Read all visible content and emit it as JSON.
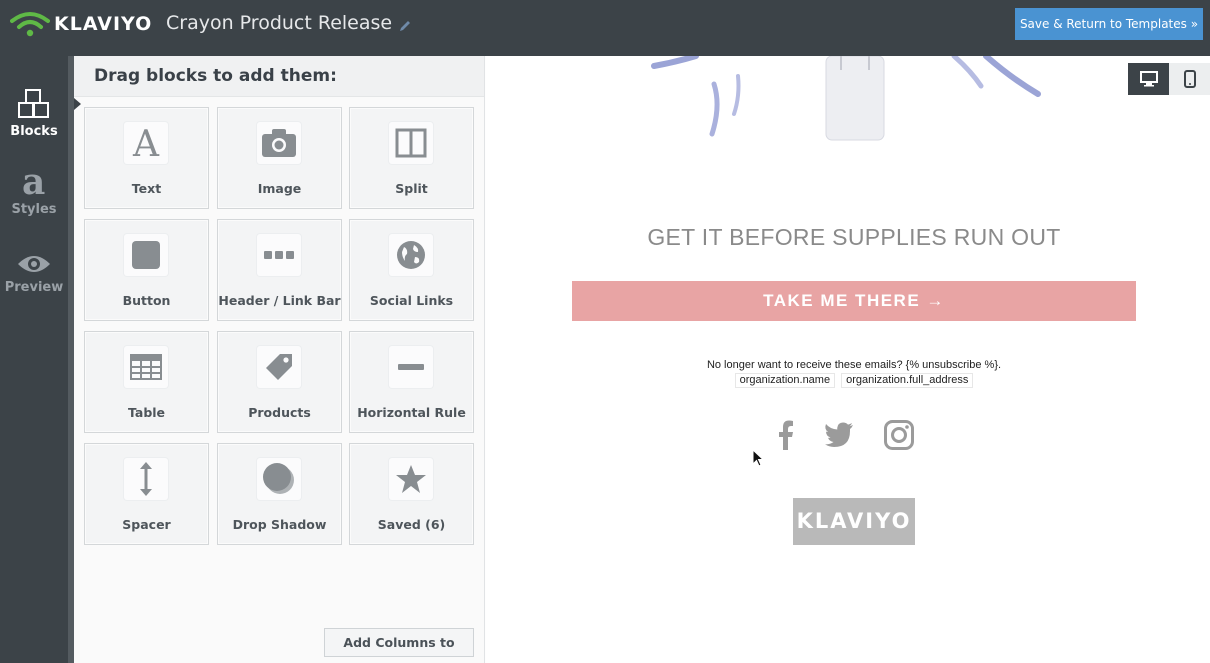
{
  "app": {
    "brand": "KLAVIYO",
    "document_title": "Crayon Product Release",
    "save_button": "Save & Return to Templates »"
  },
  "sidebar": {
    "items": [
      {
        "label": "Blocks",
        "icon": "blocks-icon",
        "active": true
      },
      {
        "label": "Styles",
        "icon": "styles-icon",
        "active": false
      },
      {
        "label": "Preview",
        "icon": "eye-icon",
        "active": false
      }
    ]
  },
  "panel": {
    "heading": "Drag blocks to add them:",
    "blocks": [
      {
        "label": "Text",
        "icon": "text-icon"
      },
      {
        "label": "Image",
        "icon": "camera-icon"
      },
      {
        "label": "Split",
        "icon": "split-icon"
      },
      {
        "label": "Button",
        "icon": "button-icon"
      },
      {
        "label": "Header / Link Bar",
        "icon": "link-bar-icon"
      },
      {
        "label": "Social Links",
        "icon": "globe-icon"
      },
      {
        "label": "Table",
        "icon": "table-icon"
      },
      {
        "label": "Products",
        "icon": "tag-icon"
      },
      {
        "label": "Horizontal Rule",
        "icon": "horizontal-rule-icon"
      },
      {
        "label": "Spacer",
        "icon": "spacer-icon"
      },
      {
        "label": "Drop Shadow",
        "icon": "drop-shadow-icon"
      },
      {
        "label": "Saved (6)",
        "icon": "star-icon"
      }
    ],
    "add_columns_button": "Add Columns to Email"
  },
  "preview": {
    "device_toggle": [
      "desktop-icon",
      "mobile-icon"
    ],
    "headline": "GET IT BEFORE SUPPLIES RUN OUT",
    "cta": "TAKE ME THERE →",
    "unsubscribe_text": "No longer want to receive these emails? {% unsubscribe %}.",
    "org_name": "organization.name",
    "org_address": "organization.full_address",
    "social_icons": [
      "facebook-icon",
      "twitter-icon",
      "instagram-icon"
    ],
    "footer_logo": "KLAVIYO"
  },
  "colors": {
    "topbar": "#3c4348",
    "accent": "#4a93d2",
    "cta": "#e8a4a4",
    "brand_green": "#5fb946"
  }
}
